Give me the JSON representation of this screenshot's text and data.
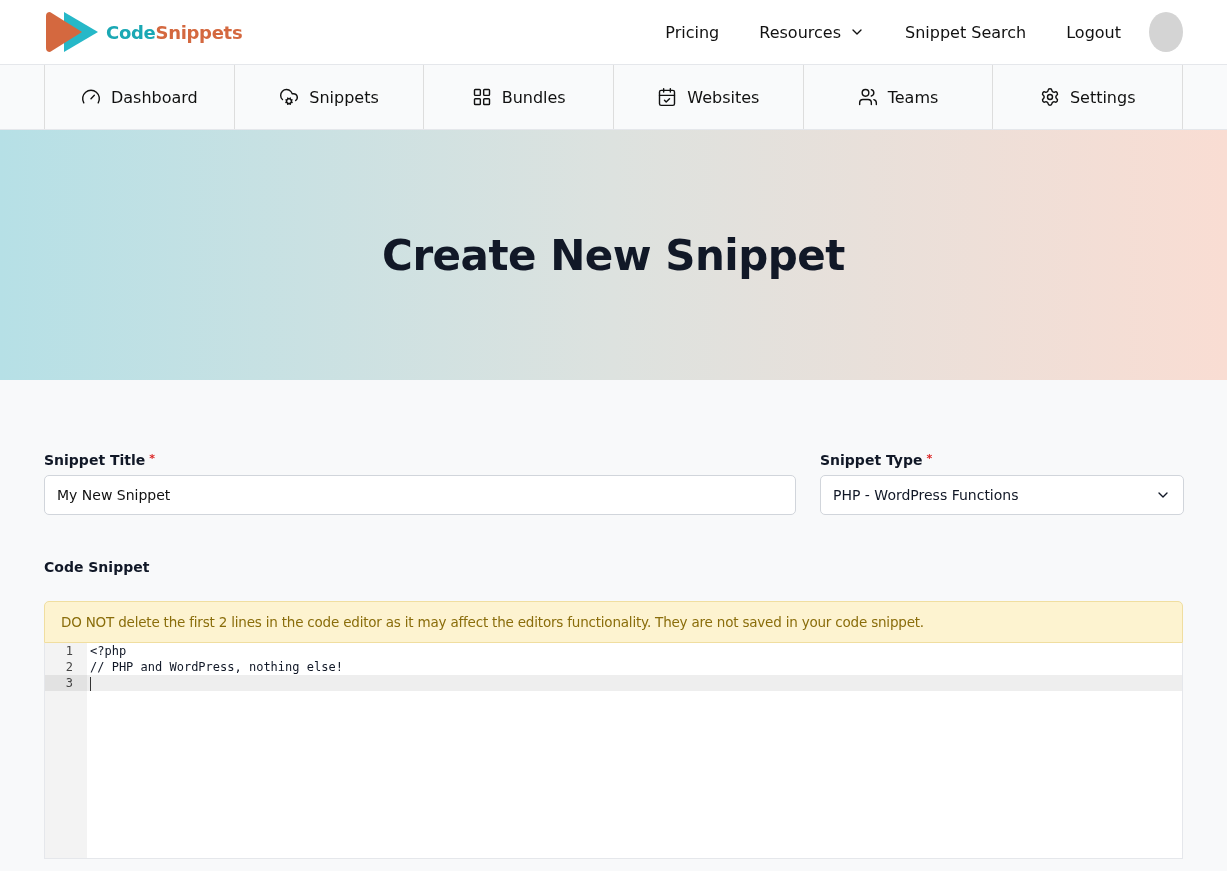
{
  "header": {
    "logo": {
      "part_1": "Code",
      "part_2": "Snippets"
    },
    "nav": [
      {
        "label": "Pricing",
        "dropdown": false
      },
      {
        "label": "Resources",
        "dropdown": true
      },
      {
        "label": "Snippet Search",
        "dropdown": false
      },
      {
        "label": "Logout",
        "dropdown": false
      }
    ]
  },
  "tabs": [
    {
      "label": "Dashboard"
    },
    {
      "label": "Snippets"
    },
    {
      "label": "Bundles"
    },
    {
      "label": "Websites"
    },
    {
      "label": "Teams"
    },
    {
      "label": "Settings"
    }
  ],
  "hero": {
    "title": "Create New Snippet"
  },
  "form": {
    "title_field": {
      "label": "Snippet Title",
      "required_mark": "*",
      "value": "My New Snippet"
    },
    "type_field": {
      "label": "Snippet Type",
      "required_mark": "*",
      "value": "PHP - WordPress Functions"
    },
    "code_label": "Code Snippet",
    "notice": "DO NOT delete the first 2 lines in the code editor as it may affect the editors functionality. They are not saved in your code snippet.",
    "code_lines": [
      {
        "number": "1",
        "text": "<?php",
        "active": false
      },
      {
        "number": "2",
        "text": "// PHP and WordPress, nothing else!",
        "active": false
      },
      {
        "number": "3",
        "active": true
      }
    ]
  }
}
